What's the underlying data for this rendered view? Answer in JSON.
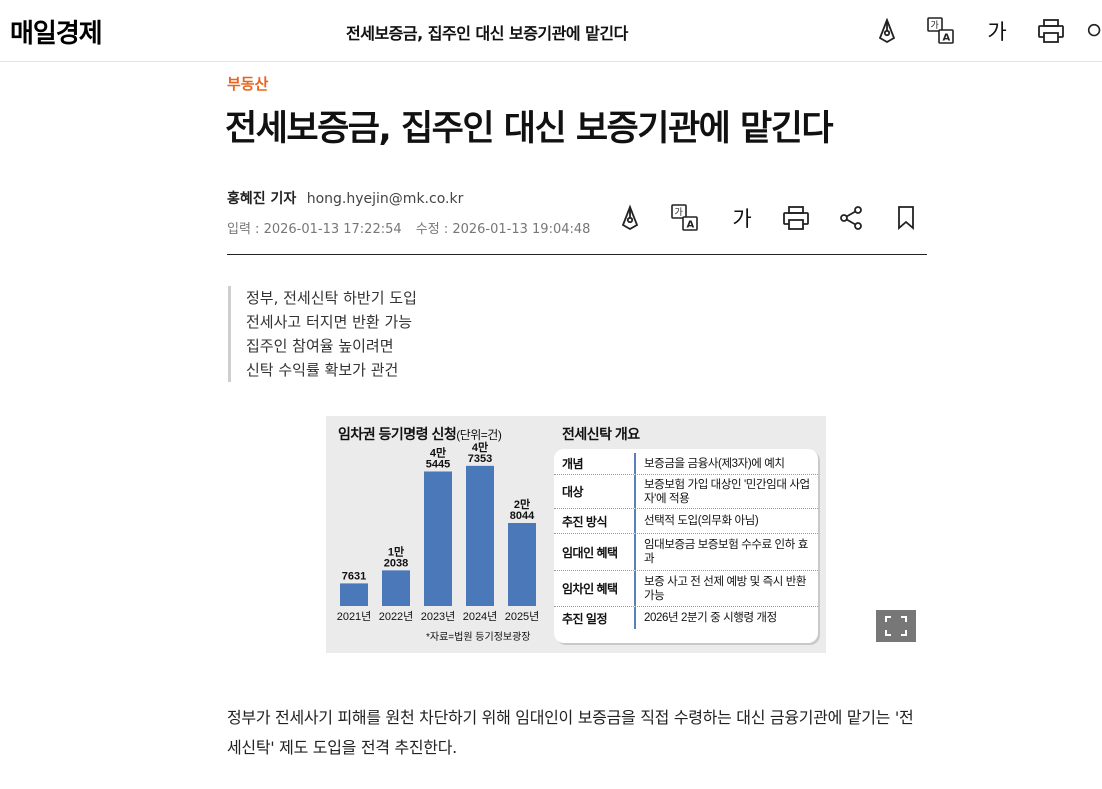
{
  "header": {
    "logo": "매일경제",
    "title": "전세보증금, 집주인 대신 보증기관에 맡긴다",
    "font_size_label": "가"
  },
  "article": {
    "category": "부동산",
    "headline": "전세보증금, 집주인 대신 보증기관에 맡긴다",
    "reporter": "홍혜진 기자",
    "email": "hong.hyejin@mk.co.kr",
    "published": "입력 : 2026-01-13 17:22:54",
    "modified": "수정 : 2026-01-13 19:04:48",
    "font_size_label": "가",
    "summary": [
      "정부, 전세신탁 하반기 도입",
      "전세사고 터지면 반환 가능",
      "집주인 참여율 높이려면",
      "신탁 수익률 확보가 관건"
    ],
    "body": "정부가 전세사기 피해를 원천 차단하기 위해 임대인이 보증금을 직접 수령하는 대신 금융기관에 맡기는 '전세신탁' 제도 도입을 전격 추진한다."
  },
  "figure": {
    "chart_title": "임차권 등기명령 신청",
    "chart_unit": "(단위=건)",
    "table_title": "전세신탁 개요",
    "source": "*자료=법원 등기정보광장",
    "table_rows": [
      {
        "key": "개념",
        "value": "보증금을 금융사(제3자)에 예치"
      },
      {
        "key": "대상",
        "value": "보증보험 가입 대상인 '민간임대 사업자'에 적용"
      },
      {
        "key": "추진 방식",
        "value": "선택적 도입(의무화 아님)"
      },
      {
        "key": "임대인 혜택",
        "value": "임대보증금 보증보험 수수료 인하 효과"
      },
      {
        "key": "임차인 혜택",
        "value": "보증 사고 전 선제 예방 및 즉시 반환 가능"
      },
      {
        "key": "추진 일정",
        "value": "2026년 2분기 중 시행령 개정"
      }
    ]
  },
  "chart_data": {
    "type": "bar",
    "title": "임차권 등기명령 신청",
    "unit": "(단위=건)",
    "categories": [
      "2021년",
      "2022년",
      "2023년",
      "2024년",
      "2025년"
    ],
    "values": [
      7631,
      12038,
      45445,
      47353,
      28044
    ],
    "value_labels": [
      [
        "7631"
      ],
      [
        "1만",
        "2038"
      ],
      [
        "4만",
        "5445"
      ],
      [
        "4만",
        "7353"
      ],
      [
        "2만",
        "8044"
      ]
    ],
    "ylim": [
      0,
      50000
    ],
    "bar_color": "#4a78b8",
    "grid": false,
    "legend": "none"
  },
  "colors": {
    "accent": "#e8651f",
    "bar": "#4a78b8",
    "table_divider": "#5b7fb8"
  },
  "icons": {
    "top": [
      "pen-icon",
      "translate-icon",
      "font-size-icon",
      "print-icon"
    ],
    "article": [
      "pen-icon",
      "translate-icon",
      "font-size-icon",
      "print-icon",
      "share-icon",
      "bookmark-icon"
    ]
  }
}
